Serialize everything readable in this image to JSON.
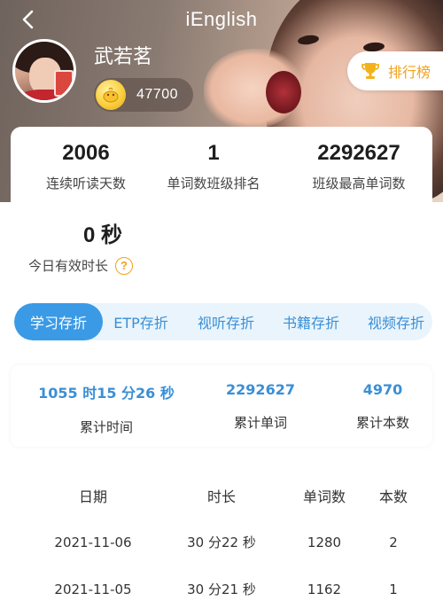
{
  "header": {
    "title": "iEnglish",
    "user_name": "武若茗",
    "coins": "47700",
    "rank_label": "排行榜"
  },
  "stats": [
    {
      "value": "2006",
      "label": "连续听读天数"
    },
    {
      "value": "1",
      "label": "单词数班级排名"
    },
    {
      "value": "2292627",
      "label": "班级最高单词数"
    },
    {
      "value": "0 秒",
      "label": "今日有效时长"
    }
  ],
  "tabs": [
    {
      "label": "学习存折",
      "active": true
    },
    {
      "label": "ETP存折",
      "active": false
    },
    {
      "label": "视听存折",
      "active": false
    },
    {
      "label": "书籍存折",
      "active": false
    },
    {
      "label": "视频存折",
      "active": false
    }
  ],
  "totals": [
    {
      "value": "1055 时15 分26 秒",
      "label": "累计时间"
    },
    {
      "value": "2292627",
      "label": "累计单词"
    },
    {
      "value": "4970",
      "label": "累计本数"
    }
  ],
  "table": {
    "columns": [
      "日期",
      "时长",
      "单词数",
      "本数"
    ],
    "rows": [
      [
        "2021-11-06",
        "30 分22 秒",
        "1280",
        "2"
      ],
      [
        "2021-11-05",
        "30 分21 秒",
        "1162",
        "1"
      ]
    ]
  },
  "colors": {
    "accent_blue": "#3a9ae6",
    "accent_text_blue": "#3a8fd6",
    "rank_orange": "#f4a11a",
    "tab_bg": "#e9f4fc"
  },
  "icons": {
    "back": "chevron-left-icon",
    "coin": "coin-icon",
    "rank": "trophy-icon",
    "help": "question-icon"
  }
}
